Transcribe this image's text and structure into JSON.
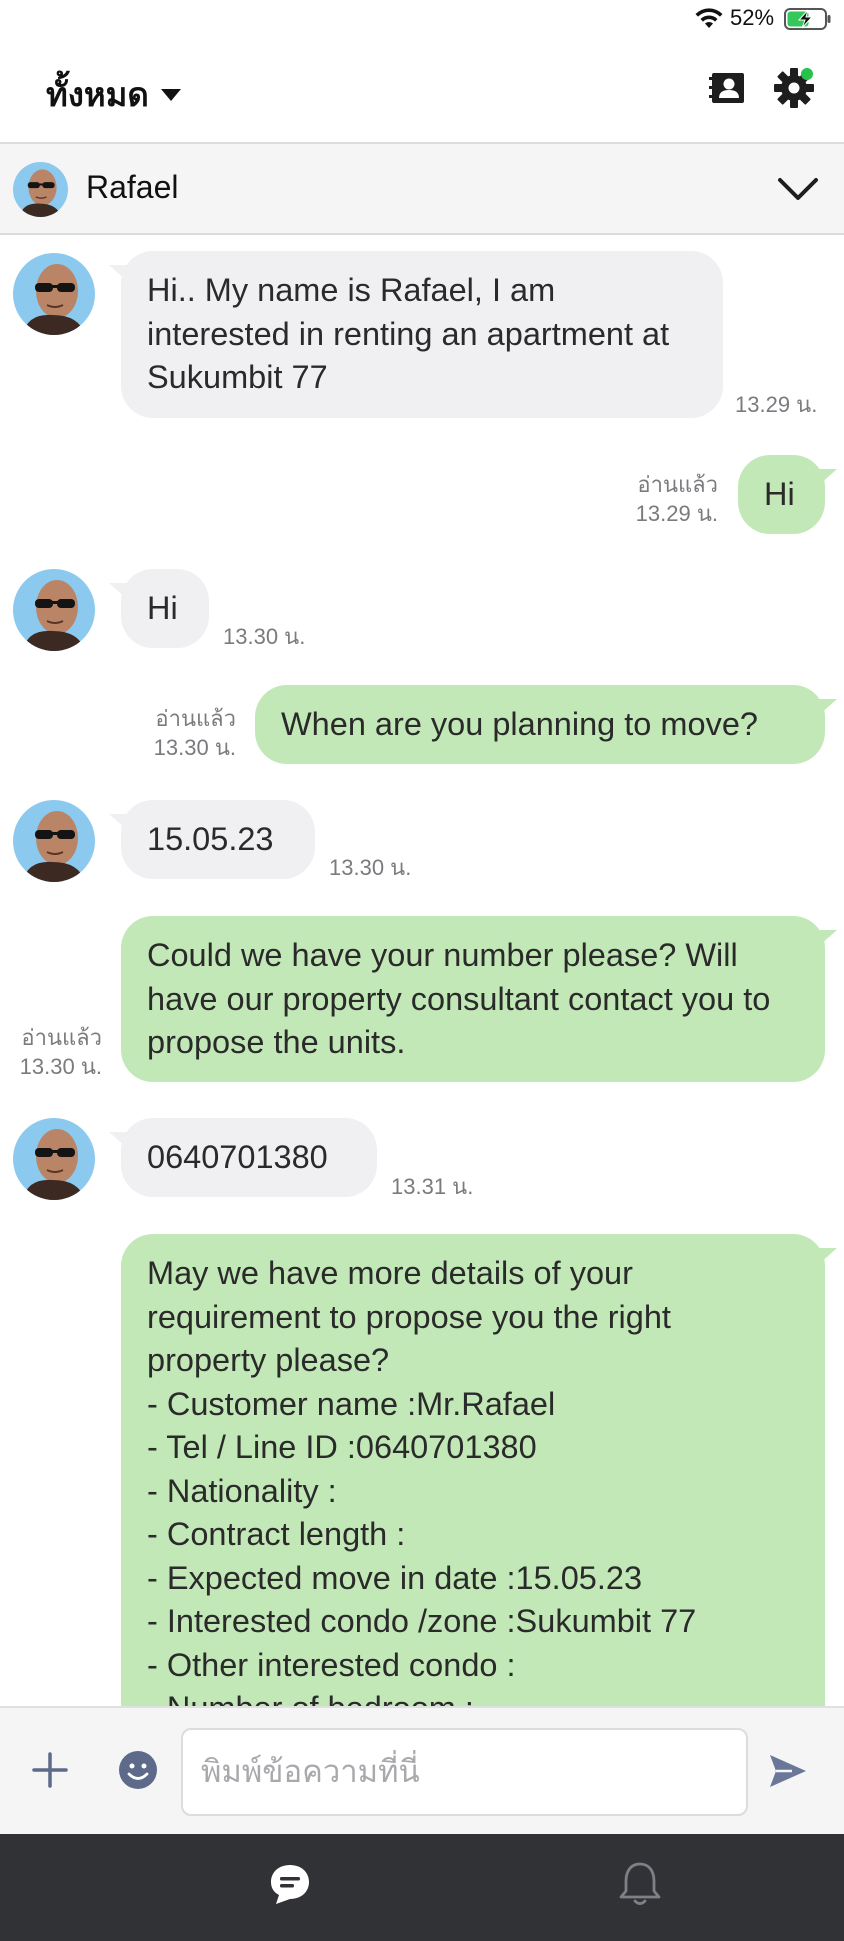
{
  "status_bar": {
    "battery_percent": "52%",
    "icons": [
      "wifi-icon",
      "battery-charging-icon"
    ]
  },
  "header": {
    "filter_label": "ทั้งหมด",
    "icons": [
      "chevron-down-icon",
      "contact-card-icon",
      "gear-icon"
    ],
    "notification_dot_color": "#27c24c"
  },
  "contact": {
    "name": "Rafael"
  },
  "messages": [
    {
      "sender": "contact",
      "text": "Hi.. My name is Rafael, I am interested in renting an apartment at Sukumbit 77",
      "time": "13.29 น."
    },
    {
      "sender": "me",
      "text": "Hi",
      "read": "อ่านแล้ว",
      "time": "13.29 น."
    },
    {
      "sender": "contact",
      "text": "Hi",
      "time": "13.30 น."
    },
    {
      "sender": "me",
      "text": "When are you planning to move?",
      "read": "อ่านแล้ว",
      "time": "13.30 น."
    },
    {
      "sender": "contact",
      "text": "15.05.23",
      "time": "13.30 น."
    },
    {
      "sender": "me",
      "text": "Could we have your number please? Will have our property consultant contact you to propose the units.",
      "read": "อ่านแล้ว",
      "time": "13.30 น."
    },
    {
      "sender": "contact",
      "text": "0640701380",
      "time": "13.31 น."
    },
    {
      "sender": "me",
      "lines": [
        "May we have more details of your",
        "requirement to propose you the right",
        "property please?",
        "- Customer name :Mr.Rafael",
        "- Tel / Line ID :0640701380",
        "- Nationality :",
        "- Contract length :",
        "- Expected move in date :15.05.23",
        "- Interested condo /zone :Sukumbit 77",
        "- Other interested condo :",
        "- Number of bedroom :"
      ]
    }
  ],
  "input": {
    "placeholder": "พิมพ์ข้อความที่นี่",
    "value": ""
  },
  "colors": {
    "incoming_bubble": "#f0f0f2",
    "outgoing_bubble": "#c3e8b7",
    "bottom_nav": "#303236"
  },
  "bottom_nav": {
    "icons": [
      "chat-icon",
      "bell-icon"
    ]
  }
}
